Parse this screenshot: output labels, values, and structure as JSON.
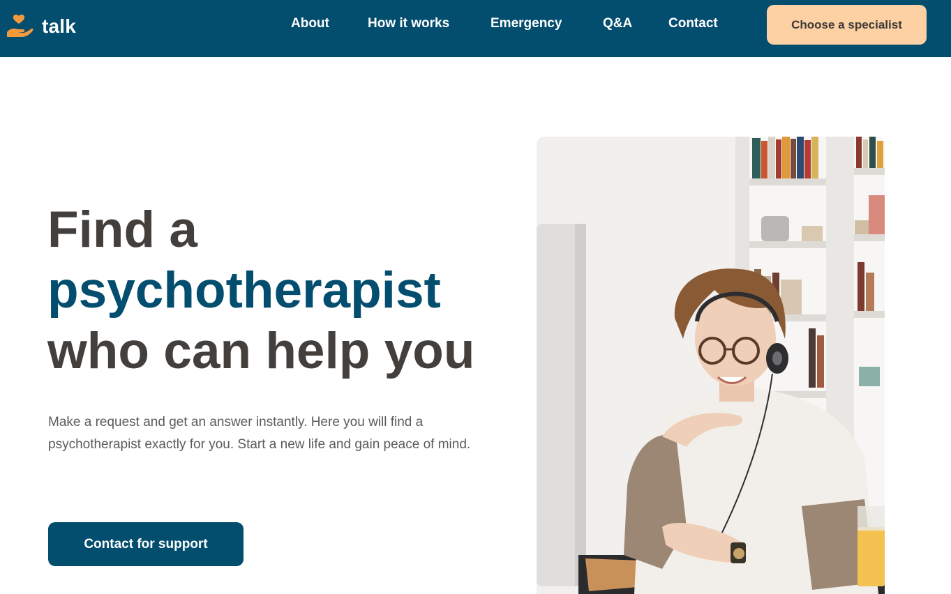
{
  "brand": {
    "name": "talk",
    "icon": "heart-hand-icon",
    "accent_color": "#f39a3d"
  },
  "nav": {
    "background": "#034d6e",
    "links": [
      "About",
      "How it works",
      "Emergency",
      "Q&A",
      "Contact"
    ],
    "cta_label": "Choose a specialist",
    "cta_color": "#fdd1a3"
  },
  "hero": {
    "title_line1": "Find a",
    "title_accent": "psychotherapist",
    "title_line3": "who can help you",
    "description": "Make a request and get an answer instantly. Here you will find a psychotherapist exactly for you. Start a new life and gain peace of mind.",
    "cta_label": "Contact for support",
    "image": "woman-with-headphones-at-computer-photo"
  }
}
